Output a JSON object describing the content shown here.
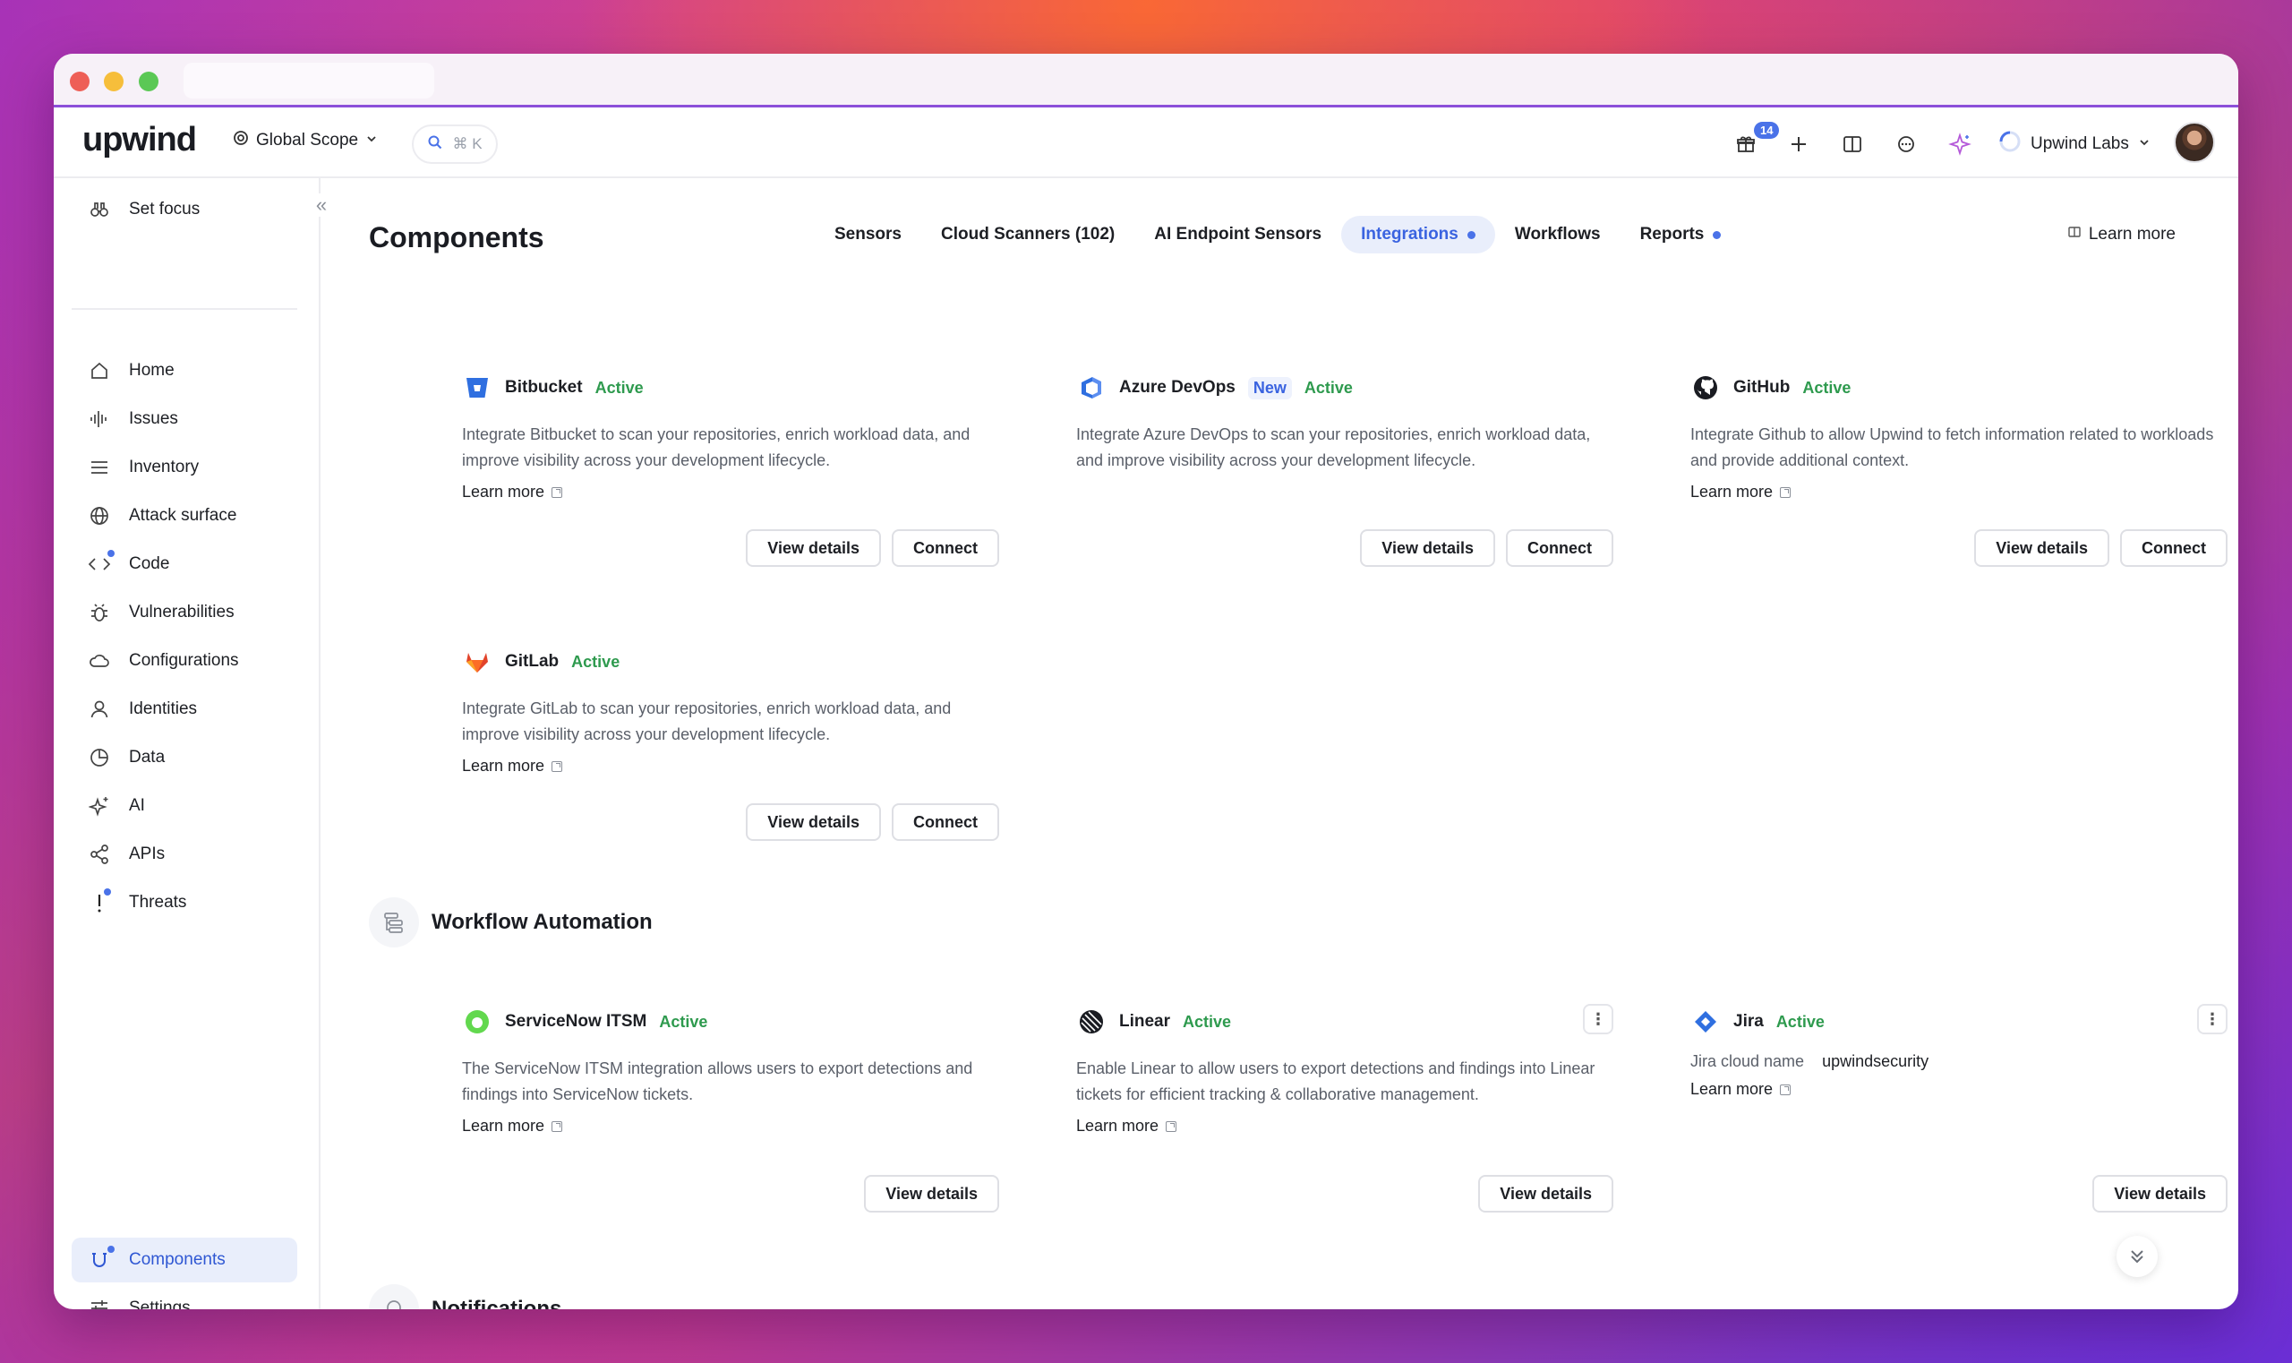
{
  "app": {
    "logo": "upwind"
  },
  "topbar": {
    "scope_label": "Global Scope",
    "search_shortcut": "⌘ K",
    "gift_badge": "14",
    "org_name": "Upwind Labs"
  },
  "sidebar": {
    "set_focus": "Set focus",
    "items": [
      {
        "label": "Home",
        "icon": "home-icon"
      },
      {
        "label": "Issues",
        "icon": "waveform-icon"
      },
      {
        "label": "Inventory",
        "icon": "list-icon"
      },
      {
        "label": "Attack surface",
        "icon": "globe-icon"
      },
      {
        "label": "Code",
        "icon": "code-icon"
      },
      {
        "label": "Vulnerabilities",
        "icon": "bug-icon"
      },
      {
        "label": "Configurations",
        "icon": "cloud-icon"
      },
      {
        "label": "Identities",
        "icon": "user-icon"
      },
      {
        "label": "Data",
        "icon": "pie-icon"
      },
      {
        "label": "AI",
        "icon": "sparkle-icon"
      },
      {
        "label": "APIs",
        "icon": "share-icon"
      },
      {
        "label": "Threats",
        "icon": "exclamation-icon"
      }
    ],
    "bottom": {
      "components": "Components",
      "settings": "Settings"
    }
  },
  "page": {
    "title": "Components",
    "tabs": [
      {
        "label": "Sensors"
      },
      {
        "label": "Cloud Scanners (102)"
      },
      {
        "label": "AI Endpoint Sensors"
      },
      {
        "label": "Integrations"
      },
      {
        "label": "Workflows"
      },
      {
        "label": "Reports"
      }
    ],
    "learn_more": "Learn more"
  },
  "integrations": [
    {
      "name": "Bitbucket",
      "status": "Active",
      "desc": "Integrate Bitbucket to scan your repositories, enrich workload data, and improve visibility across your development lifecycle.",
      "learn": "Learn more",
      "view": "View details",
      "connect": "Connect"
    },
    {
      "name": "Azure DevOps",
      "new": "New",
      "status": "Active",
      "desc": "Integrate Azure DevOps to scan your repositories, enrich workload data, and improve visibility across your development lifecycle.",
      "view": "View details",
      "connect": "Connect"
    },
    {
      "name": "GitHub",
      "status": "Active",
      "desc": "Integrate Github to allow Upwind to fetch information related to workloads and provide additional context.",
      "learn": "Learn more",
      "view": "View details",
      "connect": "Connect"
    },
    {
      "name": "GitLab",
      "status": "Active",
      "desc": "Integrate GitLab to scan your repositories, enrich workload data, and improve visibility across your development lifecycle.",
      "learn": "Learn more",
      "view": "View details",
      "connect": "Connect"
    }
  ],
  "workflow_section": {
    "title": "Workflow Automation"
  },
  "workflows": [
    {
      "name": "ServiceNow ITSM",
      "status": "Active",
      "desc": "The ServiceNow ITSM integration allows users to export detections and findings into ServiceNow tickets.",
      "learn": "Learn more",
      "view": "View details"
    },
    {
      "name": "Linear",
      "status": "Active",
      "desc": "Enable Linear to allow users to export detections and findings into Linear tickets for efficient tracking & collaborative management.",
      "learn": "Learn more",
      "view": "View details"
    },
    {
      "name": "Jira",
      "status": "Active",
      "kv_key": "Jira cloud name",
      "kv_val": "upwindsecurity",
      "learn": "Learn more",
      "view": "View details"
    }
  ],
  "notifications_section": {
    "title": "Notifications"
  }
}
